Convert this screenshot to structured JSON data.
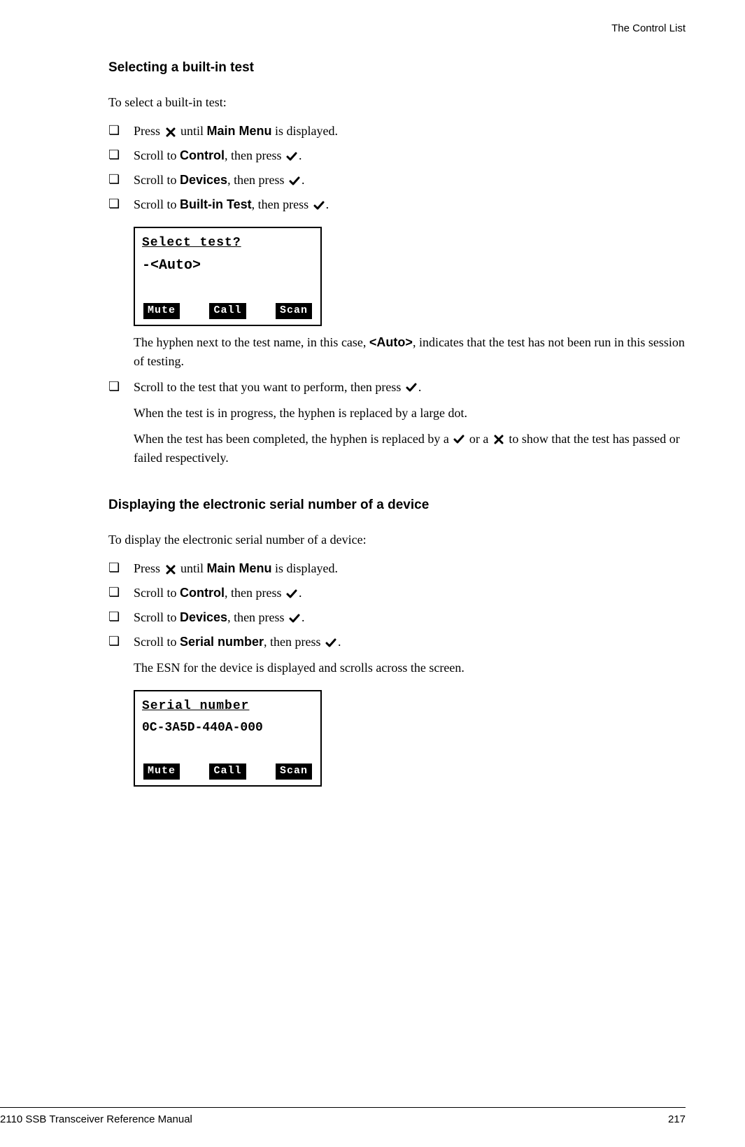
{
  "header": {
    "right": "The Control List"
  },
  "section1": {
    "heading": "Selecting a built-in test",
    "intro": "To select a built-in test:",
    "steps": [
      {
        "pre": "Press ",
        "icon": "x",
        "mid": " until ",
        "bold": "Main Menu",
        "post": " is displayed."
      },
      {
        "pre": "Scroll to ",
        "bold": "Control",
        "mid": ", then press ",
        "icon": "check",
        "post": "."
      },
      {
        "pre": "Scroll to ",
        "bold": "Devices",
        "mid": ", then press ",
        "icon": "check",
        "post": "."
      },
      {
        "pre": "Scroll to ",
        "bold": "Built-in Test",
        "mid": ", then press ",
        "icon": "check",
        "post": "."
      }
    ],
    "lcd": {
      "title": "Select test?",
      "body": "-<Auto>",
      "softkeys": [
        "Mute",
        "Call",
        "Scan"
      ]
    },
    "after1_pre": "The hyphen next to the test name, in this case, ",
    "after1_bold": "<Auto>",
    "after1_post": ", indicates that the test has not been run in this session of testing.",
    "step5_pre": "Scroll to the test that you want to perform, then press ",
    "step5_icon": "check",
    "step5_post": ".",
    "after2": "When the test is in progress, the hyphen is replaced by a large dot.",
    "after3_pre": "When the test has been completed, the hyphen is replaced by a ",
    "after3_mid": " or a ",
    "after3_post": " to show that the test has passed or failed respectively."
  },
  "section2": {
    "heading": "Displaying the electronic serial number of a device",
    "intro": "To display the electronic serial number of a device:",
    "steps": [
      {
        "pre": "Press ",
        "icon": "x",
        "mid": " until ",
        "bold": "Main Menu",
        "post": " is displayed."
      },
      {
        "pre": "Scroll to ",
        "bold": "Control",
        "mid": ", then press ",
        "icon": "check",
        "post": "."
      },
      {
        "pre": "Scroll to ",
        "bold": "Devices",
        "mid": ", then press ",
        "icon": "check",
        "post": "."
      },
      {
        "pre": "Scroll to ",
        "bold": "Serial number",
        "mid": ", then press ",
        "icon": "check",
        "post": "."
      }
    ],
    "after": "The ESN for the device is displayed and scrolls across the screen.",
    "lcd": {
      "title": "Serial number",
      "body": "0C-3A5D-440A-000",
      "softkeys": [
        "Mute",
        "Call",
        "Scan"
      ]
    }
  },
  "footer": {
    "left": "2110 SSB Transceiver Reference Manual",
    "right": "217"
  }
}
